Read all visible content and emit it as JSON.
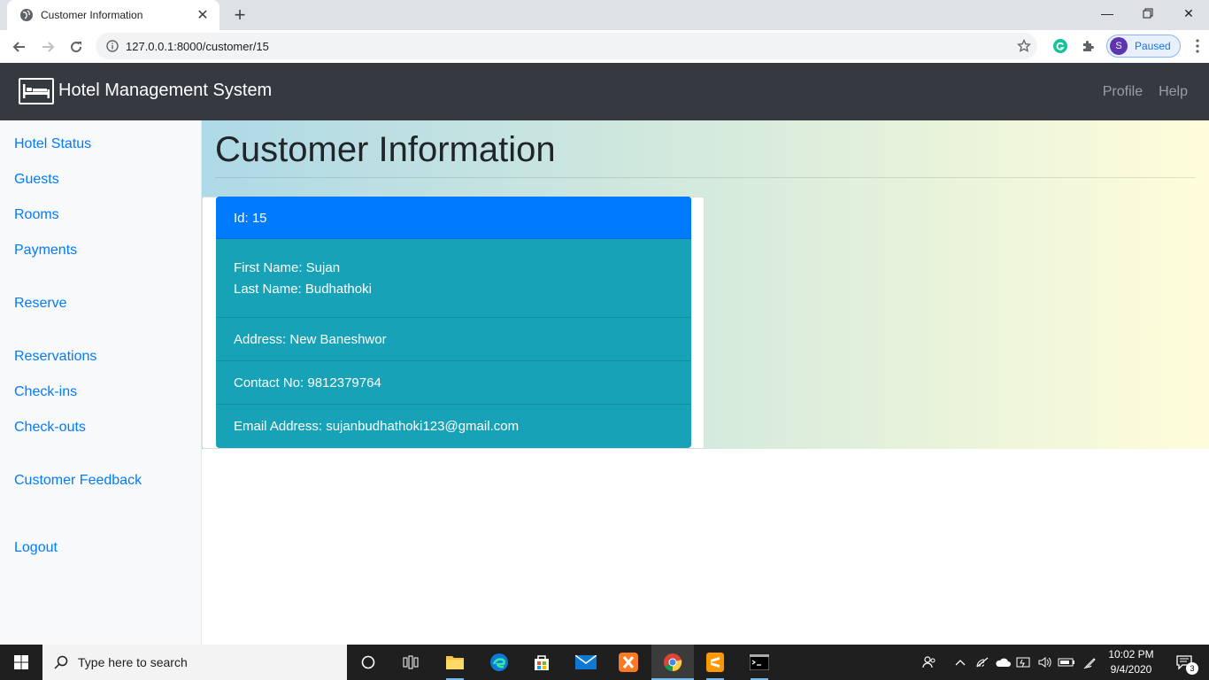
{
  "browser": {
    "tab_title": "Customer Information",
    "url": "127.0.0.1:8000/customer/15",
    "profile_initial": "S",
    "profile_status": "Paused"
  },
  "app": {
    "brand": "Hotel Management System",
    "nav": {
      "profile": "Profile",
      "help": "Help"
    }
  },
  "sidebar": {
    "items": [
      "Hotel Status",
      "Guests",
      "Rooms",
      "Payments",
      "Reserve",
      "Reservations",
      "Check-ins",
      "Check-outs",
      "Customer Feedback",
      "Logout"
    ]
  },
  "main": {
    "title": "Customer Information",
    "card": {
      "id": "Id: 15",
      "first_name": "First Name: Sujan",
      "last_name": "Last Name: Budhathoki",
      "address": "Address: New Baneshwor",
      "contact": "Contact No: 9812379764",
      "email": "Email Address: sujanbudhathoki123@gmail.com"
    }
  },
  "taskbar": {
    "search_placeholder": "Type here to search",
    "time": "10:02 PM",
    "date": "9/4/2020",
    "notifications": "3"
  },
  "colors": {
    "navbar": "#343a40",
    "link": "#007bff",
    "card_header": "#007bff",
    "card_body": "#17a2b8"
  }
}
